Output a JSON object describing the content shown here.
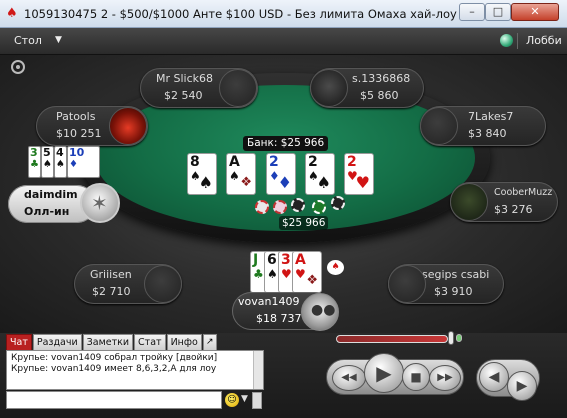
{
  "window": {
    "title": "1059130475 2 - $500/$1000 Анте $100 USD - Без лимита Омаха хай-лоу",
    "minimize": "–",
    "maximize": "□",
    "close": "✕"
  },
  "menu": {
    "table_label": "Стол",
    "lobby_label": "Лобби"
  },
  "seats": [
    {
      "name": "Mr Slick68",
      "stack": "$2 540"
    },
    {
      "name": "s.1336868",
      "stack": "$5 860"
    },
    {
      "name": "Patools",
      "stack": "$10 251"
    },
    {
      "name": "7Lakes7",
      "stack": "$3 840"
    },
    {
      "name": "CooberMuzz",
      "stack": "$3 276"
    },
    {
      "name": "Griiisen",
      "stack": "$2 710"
    },
    {
      "name": "segips csabi",
      "stack": "$3 910"
    }
  ],
  "allin_player": {
    "name": "daimdim",
    "status": "Олл-ин",
    "cards": [
      {
        "rank": "3",
        "suit": "♣",
        "color": "green"
      },
      {
        "rank": "5",
        "suit": "♠",
        "color": "black"
      },
      {
        "rank": "4",
        "suit": "♠",
        "color": "black"
      },
      {
        "rank": "10",
        "suit": "♦",
        "color": "blue"
      }
    ]
  },
  "hero": {
    "name": "vovan1409",
    "stack": "$18 737",
    "cards": [
      {
        "rank": "J",
        "suit": "♣",
        "color": "green"
      },
      {
        "rank": "6",
        "suit": "♠",
        "color": "black"
      },
      {
        "rank": "3",
        "suit": "♥",
        "color": "red"
      },
      {
        "rank": "A",
        "suit": "♥",
        "color": "red"
      }
    ]
  },
  "board": {
    "pot_label": "Банк: $25 966",
    "pot_amount": "$25 966",
    "cards": [
      {
        "rank": "8",
        "suit": "♠",
        "color": "black"
      },
      {
        "rank": "A",
        "suit": "♠",
        "color": "black"
      },
      {
        "rank": "2",
        "suit": "♦",
        "color": "blue"
      },
      {
        "rank": "2",
        "suit": "♠",
        "color": "black"
      },
      {
        "rank": "2",
        "suit": "♥",
        "color": "red"
      }
    ]
  },
  "chat": {
    "tabs": [
      "Чат",
      "Раздачи",
      "Заметки",
      "Стат",
      "Инфо"
    ],
    "tab_arrow": "↗",
    "messages": [
      "Крупье: vovan1409 собрал тройку [двойки]",
      "Крупье: vovan1409 имеет 8,6,3,2,A для лоу"
    ],
    "input_value": ""
  },
  "colors": {
    "felt": "#136c45",
    "accent_red": "#b82020",
    "blue_suit": "#1c3fb8",
    "green_suit": "#1f7a1f"
  }
}
